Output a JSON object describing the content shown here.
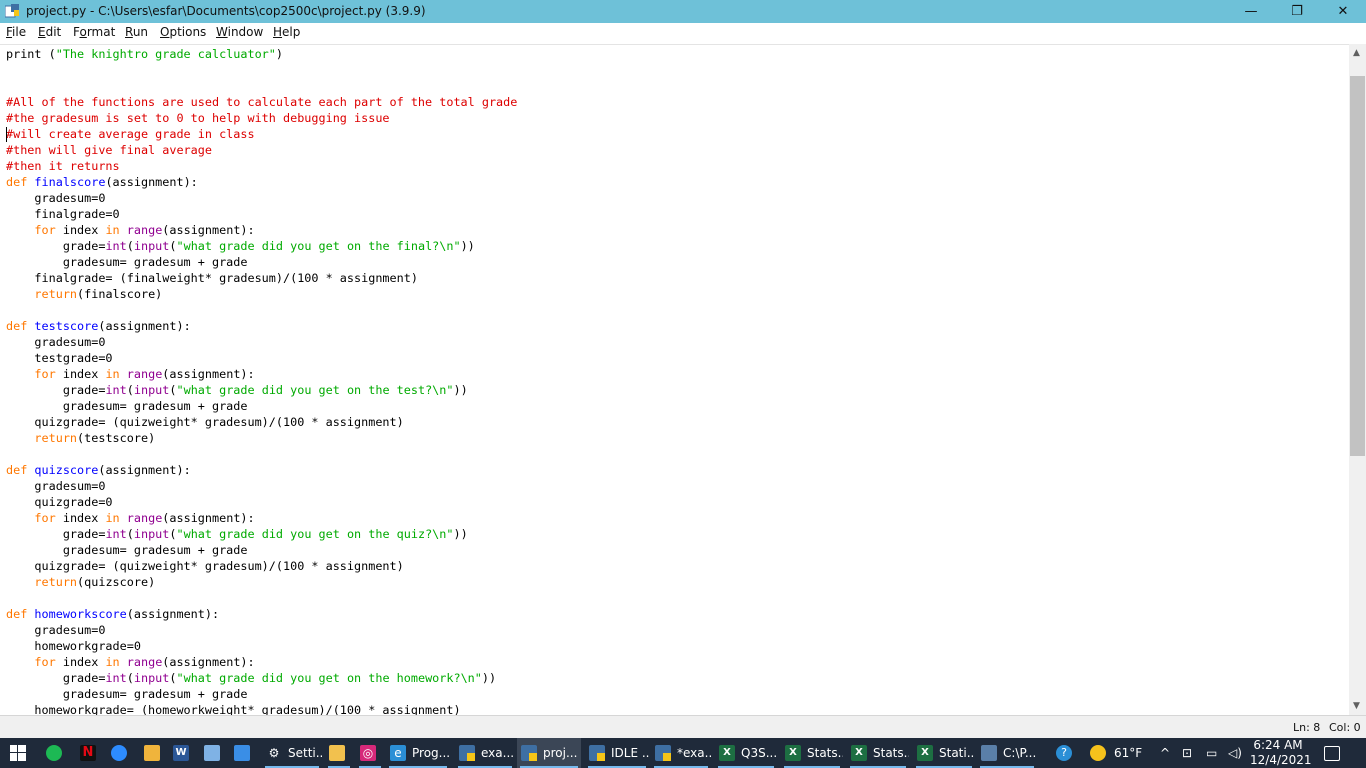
{
  "window": {
    "title": "project.py - C:\\Users\\esfar\\Documents\\cop2500c\\project.py (3.9.9)",
    "minimize": "—",
    "maximize": "❐",
    "close": "✕"
  },
  "menu": {
    "items": [
      {
        "u": "F",
        "rest": "ile"
      },
      {
        "u": "E",
        "rest": "dit"
      },
      {
        "pre": "F",
        "u": "o",
        "rest": "rmat"
      },
      {
        "u": "R",
        "rest": "un"
      },
      {
        "u": "O",
        "rest": "ptions"
      },
      {
        "u": "W",
        "rest": "indow"
      },
      {
        "u": "H",
        "rest": "elp"
      }
    ]
  },
  "code": [
    [
      [
        "",
        "print ("
      ],
      [
        "st",
        "\"The knightro grade calcluator\""
      ],
      [
        "",
        ")"
      ]
    ],
    [],
    [],
    [
      [
        "cm",
        "#All of the functions are used to calculate each part of the total grade"
      ]
    ],
    [
      [
        "cm",
        "#the gradesum is set to 0 to help with debugging issue"
      ]
    ],
    [
      [
        "cm",
        "#will create average grade in class"
      ]
    ],
    [
      [
        "cm",
        "#then will give final average"
      ]
    ],
    [
      [
        "cm",
        "#then it returns"
      ]
    ],
    [
      [
        "kw",
        "def "
      ],
      [
        "fn",
        "finalscore"
      ],
      [
        "",
        "(assignment):"
      ]
    ],
    [
      [
        "",
        "    gradesum=0"
      ]
    ],
    [
      [
        "",
        "    finalgrade=0"
      ]
    ],
    [
      [
        "",
        "    "
      ],
      [
        "kw",
        "for"
      ],
      [
        "",
        " index "
      ],
      [
        "kw",
        "in"
      ],
      [
        "",
        " "
      ],
      [
        "bi",
        "range"
      ],
      [
        "",
        "(assignment):"
      ]
    ],
    [
      [
        "",
        "        grade="
      ],
      [
        "bi",
        "int"
      ],
      [
        "",
        "("
      ],
      [
        "bi",
        "input"
      ],
      [
        "",
        "("
      ],
      [
        "st",
        "\"what grade did you get on the final?\\n\""
      ],
      [
        "",
        "))"
      ]
    ],
    [
      [
        "",
        "        gradesum= gradesum + grade"
      ]
    ],
    [
      [
        "",
        "    finalgrade= (finalweight* gradesum)/(100 * assignment)"
      ]
    ],
    [
      [
        "",
        "    "
      ],
      [
        "kw",
        "return"
      ],
      [
        "",
        "(finalscore)"
      ]
    ],
    [],
    [
      [
        "kw",
        "def "
      ],
      [
        "fn",
        "testscore"
      ],
      [
        "",
        "(assignment):"
      ]
    ],
    [
      [
        "",
        "    gradesum=0"
      ]
    ],
    [
      [
        "",
        "    testgrade=0"
      ]
    ],
    [
      [
        "",
        "    "
      ],
      [
        "kw",
        "for"
      ],
      [
        "",
        " index "
      ],
      [
        "kw",
        "in"
      ],
      [
        "",
        " "
      ],
      [
        "bi",
        "range"
      ],
      [
        "",
        "(assignment):"
      ]
    ],
    [
      [
        "",
        "        grade="
      ],
      [
        "bi",
        "int"
      ],
      [
        "",
        "("
      ],
      [
        "bi",
        "input"
      ],
      [
        "",
        "("
      ],
      [
        "st",
        "\"what grade did you get on the test?\\n\""
      ],
      [
        "",
        "))"
      ]
    ],
    [
      [
        "",
        "        gradesum= gradesum + grade"
      ]
    ],
    [
      [
        "",
        "    quizgrade= (quizweight* gradesum)/(100 * assignment)"
      ]
    ],
    [
      [
        "",
        "    "
      ],
      [
        "kw",
        "return"
      ],
      [
        "",
        "(testscore)"
      ]
    ],
    [],
    [
      [
        "kw",
        "def "
      ],
      [
        "fn",
        "quizscore"
      ],
      [
        "",
        "(assignment):"
      ]
    ],
    [
      [
        "",
        "    gradesum=0"
      ]
    ],
    [
      [
        "",
        "    quizgrade=0"
      ]
    ],
    [
      [
        "",
        "    "
      ],
      [
        "kw",
        "for"
      ],
      [
        "",
        " index "
      ],
      [
        "kw",
        "in"
      ],
      [
        "",
        " "
      ],
      [
        "bi",
        "range"
      ],
      [
        "",
        "(assignment):"
      ]
    ],
    [
      [
        "",
        "        grade="
      ],
      [
        "bi",
        "int"
      ],
      [
        "",
        "("
      ],
      [
        "bi",
        "input"
      ],
      [
        "",
        "("
      ],
      [
        "st",
        "\"what grade did you get on the quiz?\\n\""
      ],
      [
        "",
        "))"
      ]
    ],
    [
      [
        "",
        "        gradesum= gradesum + grade"
      ]
    ],
    [
      [
        "",
        "    quizgrade= (quizweight* gradesum)/(100 * assignment)"
      ]
    ],
    [
      [
        "",
        "    "
      ],
      [
        "kw",
        "return"
      ],
      [
        "",
        "(quizscore)"
      ]
    ],
    [],
    [
      [
        "kw",
        "def "
      ],
      [
        "fn",
        "homeworkscore"
      ],
      [
        "",
        "(assignment):"
      ]
    ],
    [
      [
        "",
        "    gradesum=0"
      ]
    ],
    [
      [
        "",
        "    homeworkgrade=0"
      ]
    ],
    [
      [
        "",
        "    "
      ],
      [
        "kw",
        "for"
      ],
      [
        "",
        " index "
      ],
      [
        "kw",
        "in"
      ],
      [
        "",
        " "
      ],
      [
        "bi",
        "range"
      ],
      [
        "",
        "(assignment):"
      ]
    ],
    [
      [
        "",
        "        grade="
      ],
      [
        "bi",
        "int"
      ],
      [
        "",
        "("
      ],
      [
        "bi",
        "input"
      ],
      [
        "",
        "("
      ],
      [
        "st",
        "\"what grade did you get on the homework?\\n\""
      ],
      [
        "",
        "))"
      ]
    ],
    [
      [
        "",
        "        gradesum= gradesum + grade"
      ]
    ],
    [
      [
        "",
        "    homeworkgrade= (homeworkweight* gradesum)/(100 * assignment)"
      ]
    ]
  ],
  "status": {
    "ln": "Ln: 8",
    "col": "Col: 0"
  },
  "taskbar": {
    "buttons": [
      {
        "name": "settings",
        "label": "Setti...",
        "icon": "gear-icon",
        "color": "transparent",
        "glyph": "⚙"
      },
      {
        "name": "file-explorer",
        "label": "",
        "icon": "folder-icon",
        "color": "#f2c14e",
        "glyph": ""
      },
      {
        "name": "instagram",
        "label": "",
        "icon": "instagram-icon",
        "color": "#d6297a",
        "glyph": "◎"
      },
      {
        "name": "edge-prog",
        "label": "Prog...",
        "icon": "edge-icon",
        "color": "#2b8fd6",
        "glyph": "e"
      },
      {
        "name": "idle-exa",
        "label": "exa...",
        "icon": "python-idle-icon",
        "color": "py",
        "glyph": ""
      },
      {
        "name": "idle-proj",
        "label": "proj...",
        "icon": "python-idle-icon",
        "color": "py",
        "glyph": ""
      },
      {
        "name": "idle-shell",
        "label": "IDLE ...",
        "icon": "python-idle-icon",
        "color": "py",
        "glyph": ""
      },
      {
        "name": "idle-exa2",
        "label": "*exa...",
        "icon": "python-idle-icon",
        "color": "py",
        "glyph": ""
      },
      {
        "name": "excel-q3s",
        "label": "Q3S...",
        "icon": "excel-icon",
        "color": "xl",
        "glyph": "X"
      },
      {
        "name": "excel-stats1",
        "label": "Stats...",
        "icon": "excel-icon",
        "color": "xl",
        "glyph": "X"
      },
      {
        "name": "excel-stats2",
        "label": "Stats...",
        "icon": "excel-icon",
        "color": "xl",
        "glyph": "X"
      },
      {
        "name": "excel-stati",
        "label": "Stati...",
        "icon": "excel-icon",
        "color": "xl",
        "glyph": "X"
      },
      {
        "name": "cmd-cp",
        "label": "C:\\P...",
        "icon": "terminal-icon",
        "color": "#5a7fa8",
        "glyph": ""
      }
    ],
    "weather": "61°F",
    "time": "6:24 AM",
    "date": "12/4/2021"
  },
  "colors": {
    "titlebar": "#6ec1d8",
    "keyword": "#ff7700",
    "builtin": "#900090",
    "definition": "#0000ff",
    "string": "#00aa00",
    "comment": "#dd0000",
    "taskbar": "#1f2a3a"
  }
}
